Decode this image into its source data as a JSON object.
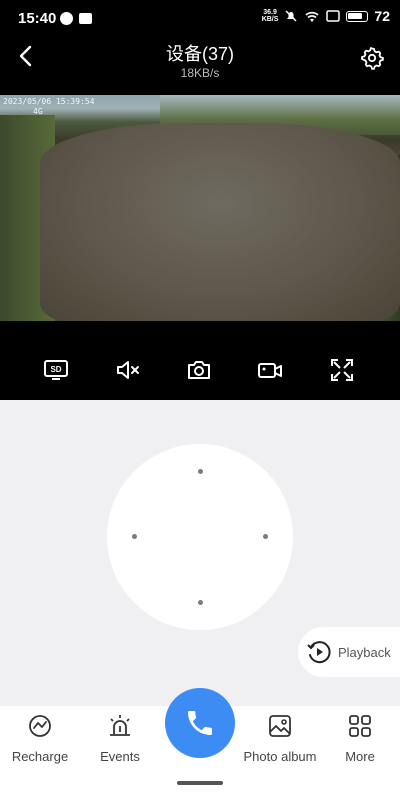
{
  "status": {
    "time": "15:40",
    "netspeed_value": "36.9",
    "netspeed_unit": "KB/S",
    "battery": "72"
  },
  "header": {
    "title": "设备(37)",
    "subtitle": "18KB/s"
  },
  "video": {
    "osd_line1": "2023/05/06 15:39:54",
    "osd_line2": "4G"
  },
  "controls": [
    {
      "name": "sd-button",
      "icon": "sd-card-icon",
      "label": "SD"
    },
    {
      "name": "mute-button",
      "icon": "speaker-muted-icon"
    },
    {
      "name": "snapshot-button",
      "icon": "camera-icon"
    },
    {
      "name": "record-button",
      "icon": "video-camera-icon"
    },
    {
      "name": "fullscreen-button",
      "icon": "expand-icon"
    }
  ],
  "playback": {
    "label": "Playback"
  },
  "tabs": [
    {
      "label": "Recharge",
      "icon": "recharge-icon"
    },
    {
      "label": "Events",
      "icon": "alarm-light-icon"
    },
    {
      "label": "Photo album",
      "icon": "image-icon"
    },
    {
      "label": "More",
      "icon": "grid-icon"
    }
  ],
  "colors": {
    "accent": "#3d8cf3",
    "top_bg": "#000000",
    "page_bg": "#f0f0f3"
  }
}
